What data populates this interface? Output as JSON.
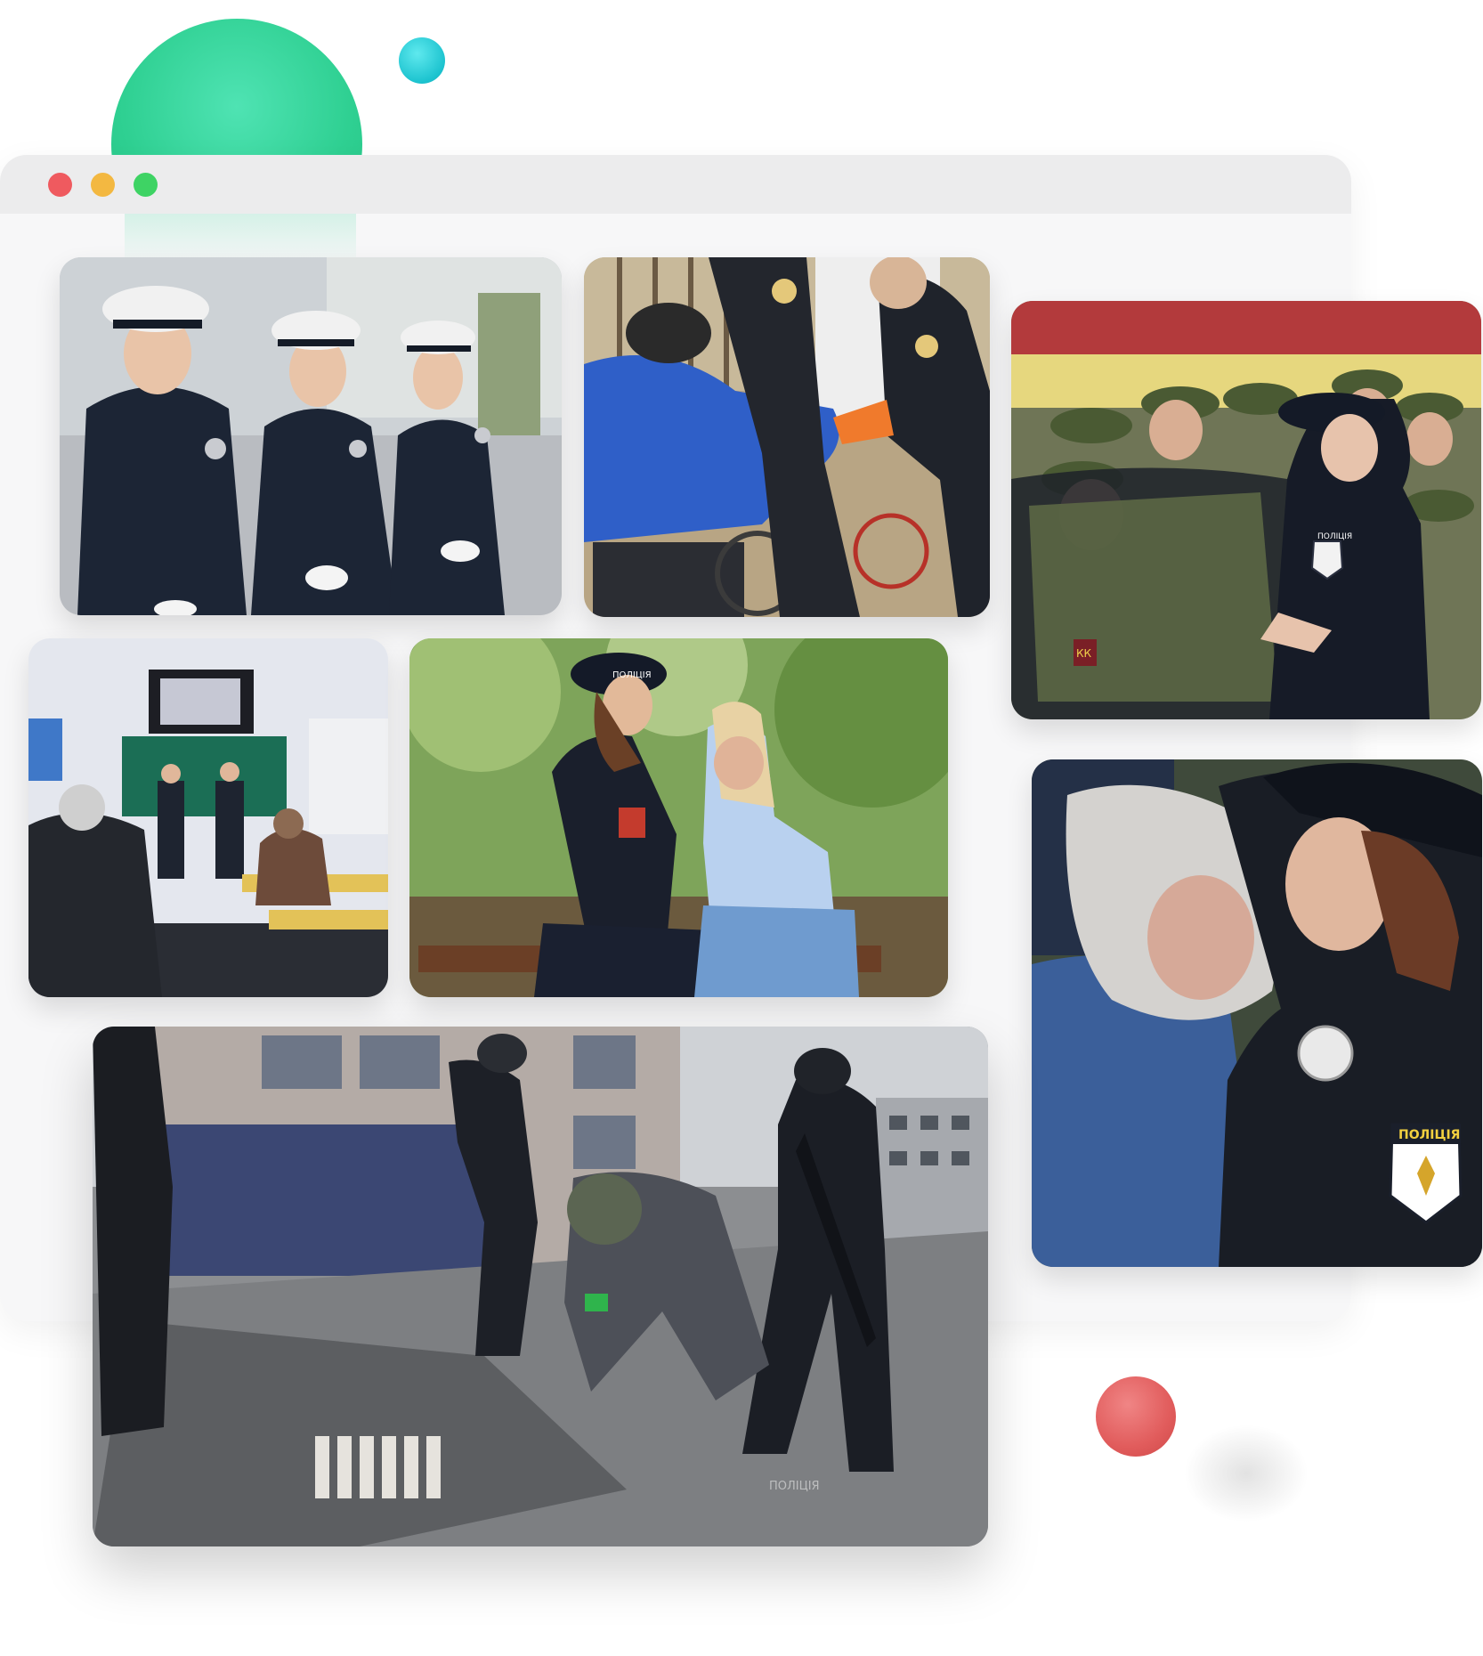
{
  "colors": {
    "accent_green": "#2fd092",
    "accent_teal": "#1cc3cf",
    "accent_red": "#e15c5c",
    "traffic_red": "#ef5a5f",
    "traffic_yellow": "#f3b841",
    "traffic_green": "#3ed364",
    "window_bg": "#f7f7f8",
    "titlebar_bg": "#ececed"
  },
  "photos": [
    {
      "name": "photo-police-cadets-caps",
      "alt": "Police officers in white caps seated"
    },
    {
      "name": "photo-police-wheelchair-help",
      "alt": "Police officers helping a person in a wheelchair"
    },
    {
      "name": "photo-police-officer-with-cadets",
      "alt": "Female police officer with young cadets near a car"
    },
    {
      "name": "photo-police-classroom-lecture",
      "alt": "Police officers presenting in a classroom"
    },
    {
      "name": "photo-police-comforting-woman",
      "alt": "Police officer comforting a crying woman on a bench"
    },
    {
      "name": "photo-police-hugging-elderly-woman",
      "alt": "Police officer hugging an elderly woman"
    },
    {
      "name": "photo-police-rubble-rescue",
      "alt": "Armed police officers searching through rubble"
    }
  ],
  "labels": {
    "cap_text": "ПОЛІЦІЯ",
    "patch_text": "ПОЛІЦІЯ",
    "back_text": "ПОЛІЦІЯ",
    "leg_text": "ПОЛІЦІЯ",
    "patch_kk": "КК"
  }
}
